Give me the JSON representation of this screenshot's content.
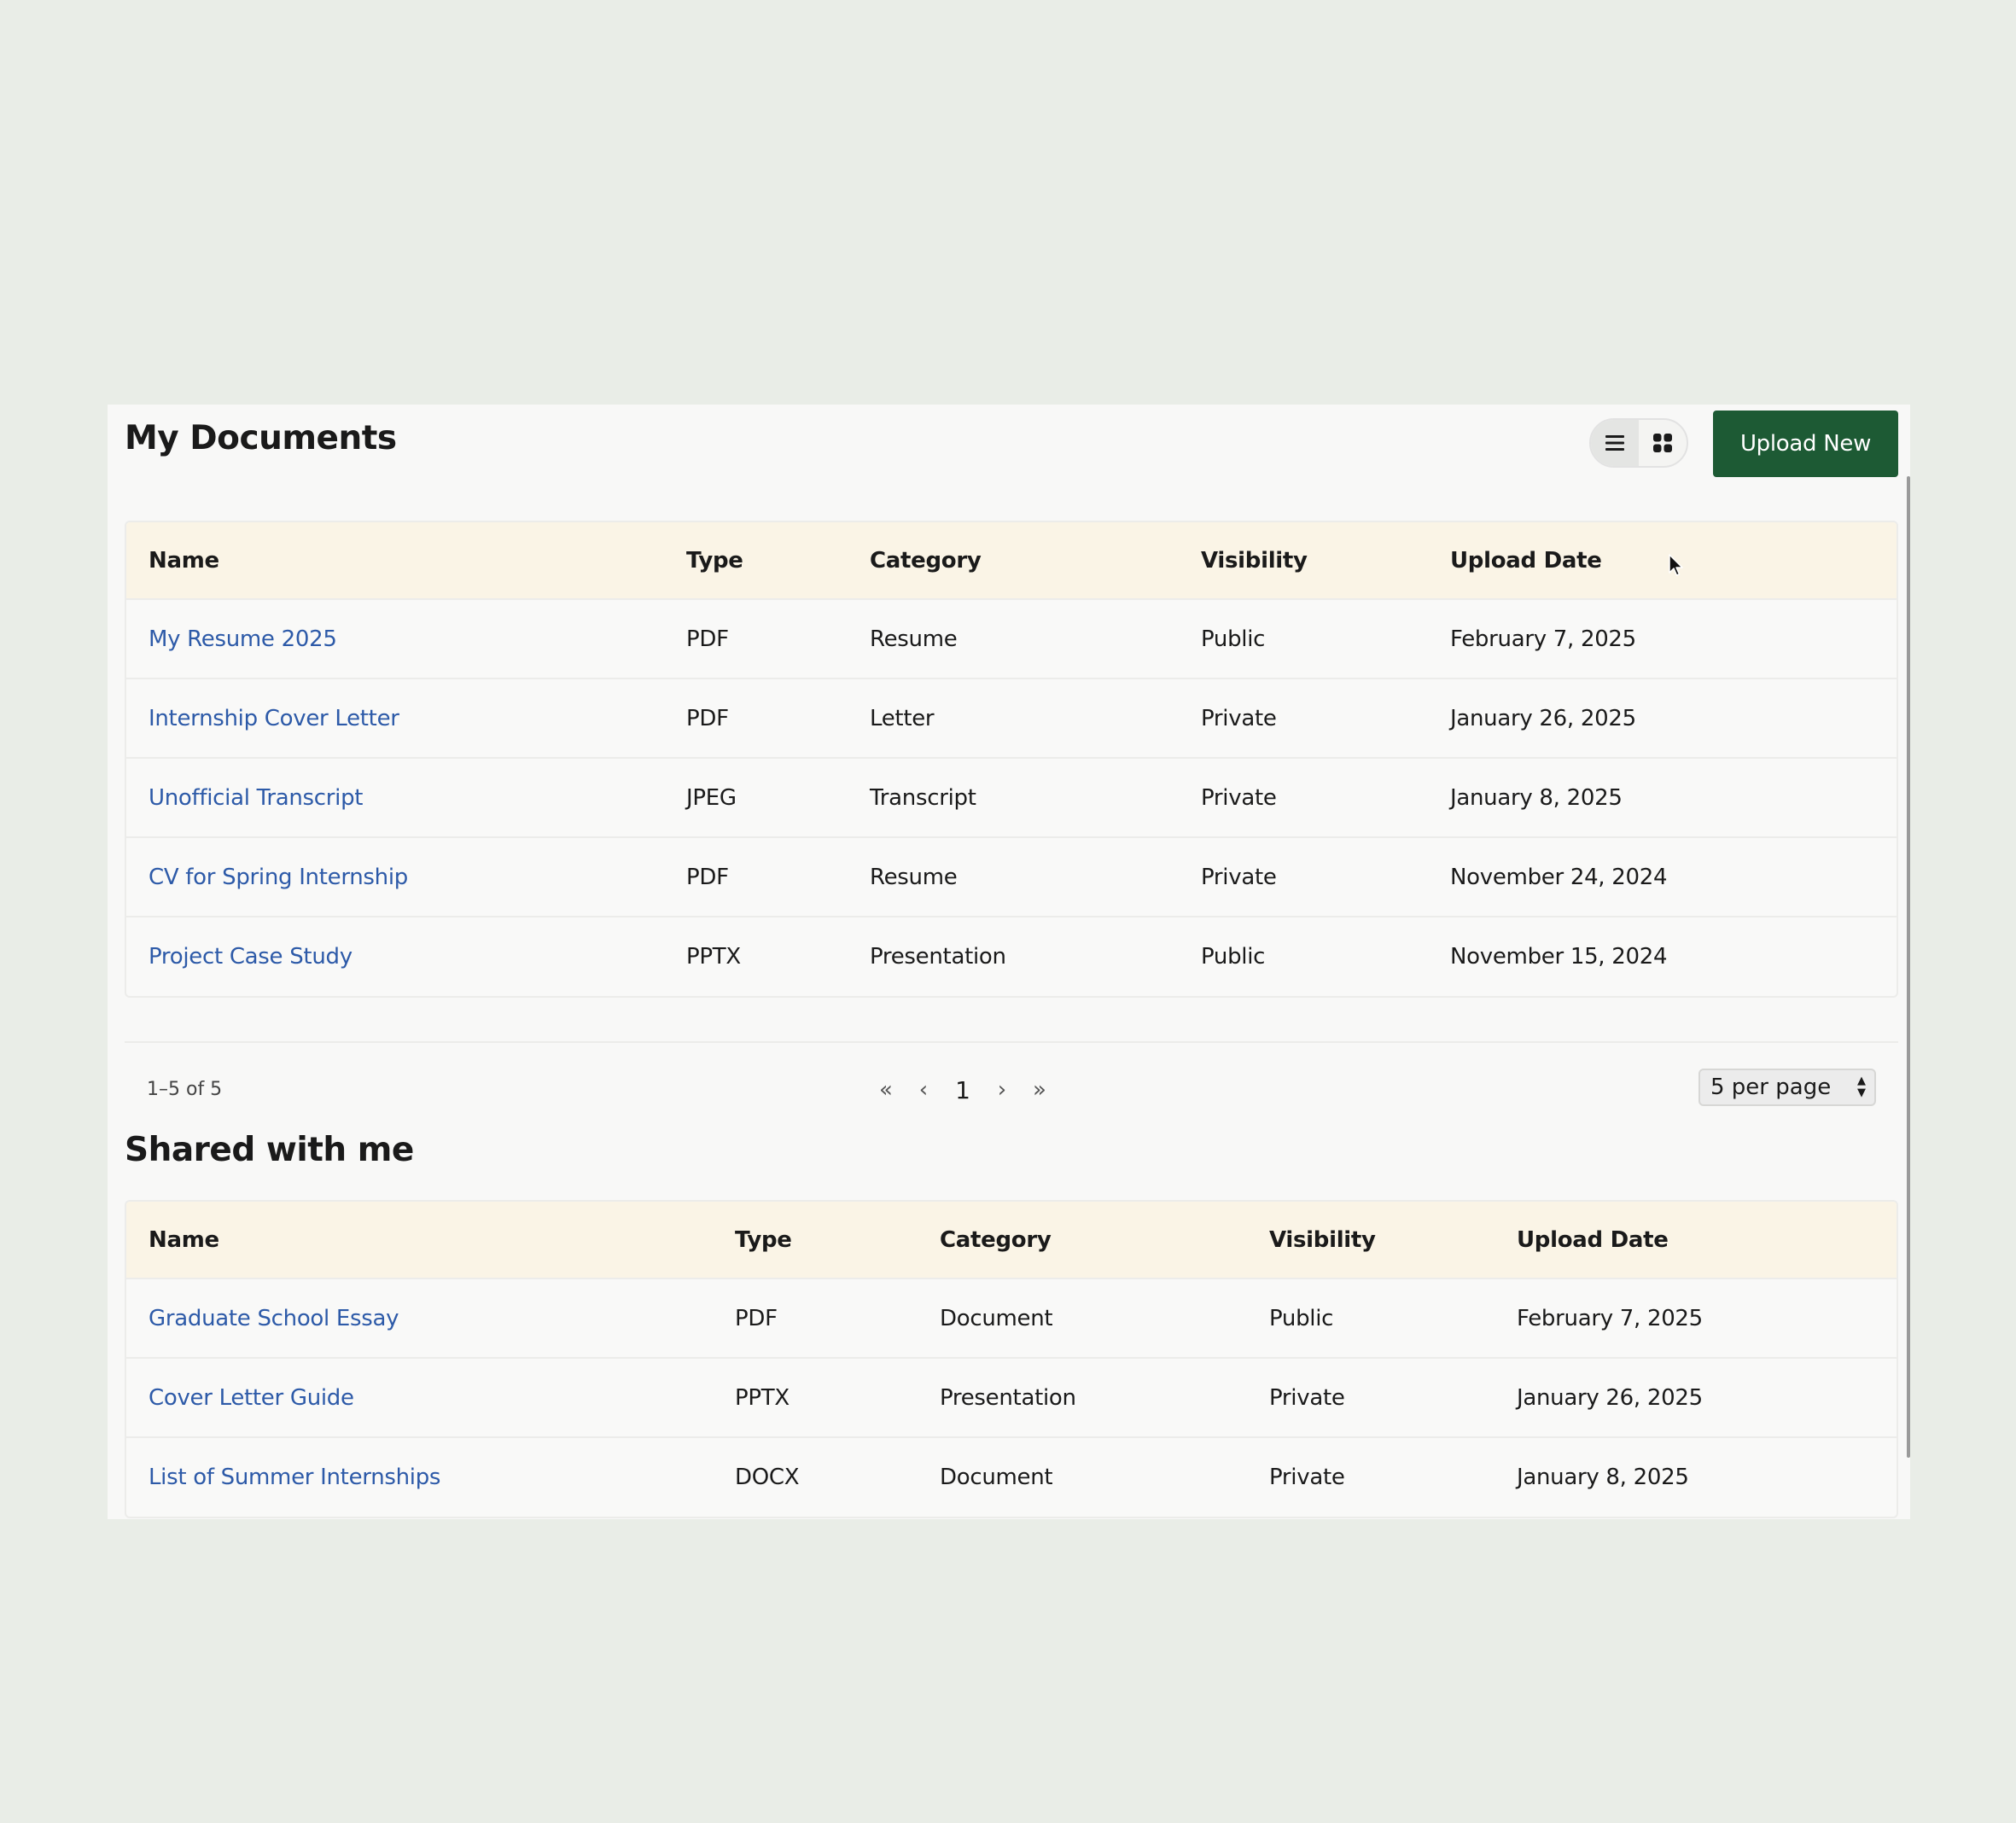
{
  "header": {
    "title": "My Documents",
    "upload_label": "Upload New"
  },
  "my_documents": {
    "columns": [
      "Name",
      "Type",
      "Category",
      "Visibility",
      "Upload Date"
    ],
    "rows": [
      [
        "My Resume 2025",
        "PDF",
        "Resume",
        "Public",
        "February 7, 2025"
      ],
      [
        "Internship Cover Letter",
        "PDF",
        "Letter",
        "Private",
        "January 26, 2025"
      ],
      [
        "Unofficial Transcript",
        "JPEG",
        "Transcript",
        "Private",
        "January 8, 2025"
      ],
      [
        "CV for Spring Internship",
        "PDF",
        "Resume",
        "Private",
        "November 24, 2024"
      ],
      [
        "Project Case Study",
        "PPTX",
        "Presentation",
        "Public",
        "November 15, 2024"
      ]
    ]
  },
  "pagination": {
    "range": "1–5 of 5",
    "first": "«",
    "prev": "‹",
    "current_page": "1",
    "next": "›",
    "last": "»",
    "per_page": "5 per page"
  },
  "shared": {
    "title": "Shared with me",
    "columns": [
      "Name",
      "Type",
      "Category",
      "Visibility",
      "Upload Date"
    ],
    "rows": [
      [
        "Graduate School Essay",
        "PDF",
        "Document",
        "Public",
        "February 7, 2025"
      ],
      [
        "Cover Letter Guide",
        "PPTX",
        "Presentation",
        "Private",
        "January 26, 2025"
      ],
      [
        "List of Summer Internships",
        "DOCX",
        "Document",
        "Private",
        "January 8, 2025"
      ]
    ]
  },
  "icons": {
    "list_view": "list-icon",
    "grid_view": "grid-icon"
  },
  "colors": {
    "accent": "#1d5a34",
    "link": "#2d5aa8",
    "header_row": "#faf4e6",
    "background": "#e9ede7"
  }
}
